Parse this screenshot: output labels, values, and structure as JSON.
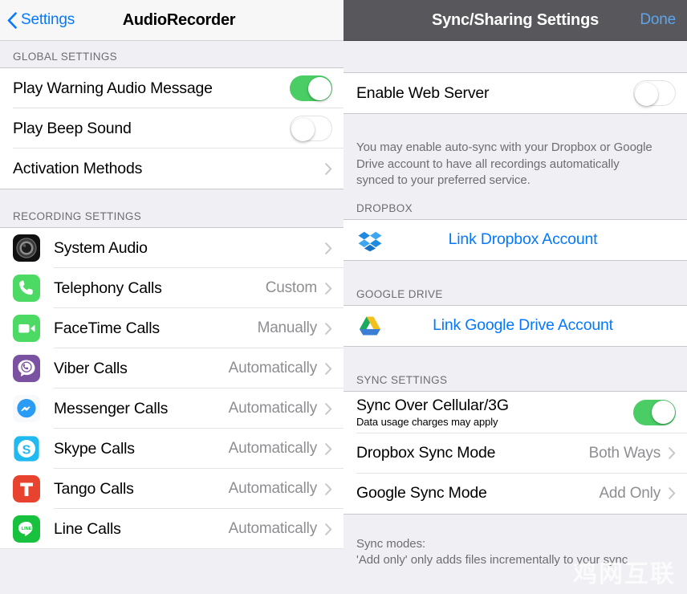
{
  "colors": {
    "accent_blue": "#0479ff",
    "done_blue": "#5ba5f0",
    "switch_on_green": "#4acd64",
    "navbar_dark": "#58585c",
    "navbar_light": "#f7f7f8",
    "group_bg": "#ffffff",
    "page_bg": "#efeff4",
    "separator": "#c8c7cc",
    "secondary_text": "#8e8e93",
    "section_header_text": "#6d6d72"
  },
  "left_panel": {
    "navbar": {
      "back_label": "Settings",
      "back_icon": "chevron-left-icon",
      "title": "AudioRecorder"
    },
    "sections": [
      {
        "header": "GLOBAL SETTINGS",
        "rows": [
          {
            "label": "Play Warning Audio Message",
            "control": "switch",
            "switch_state": "on"
          },
          {
            "label": "Play Beep Sound",
            "control": "switch",
            "switch_state": "off"
          },
          {
            "label": "Activation Methods",
            "control": "chevron",
            "detail": ""
          }
        ]
      },
      {
        "header": "RECORDING SETTINGS",
        "rows": [
          {
            "label": "System Audio",
            "icon": "system-audio-icon",
            "detail": "",
            "control": "chevron"
          },
          {
            "label": "Telephony Calls",
            "icon": "phone-icon",
            "detail": "Custom",
            "control": "chevron"
          },
          {
            "label": "FaceTime Calls",
            "icon": "facetime-icon",
            "detail": "Manually",
            "control": "chevron"
          },
          {
            "label": "Viber Calls",
            "icon": "viber-icon",
            "detail": "Automatically",
            "control": "chevron"
          },
          {
            "label": "Messenger Calls",
            "icon": "messenger-icon",
            "detail": "Automatically",
            "control": "chevron"
          },
          {
            "label": "Skype Calls",
            "icon": "skype-icon",
            "detail": "Automatically",
            "control": "chevron"
          },
          {
            "label": "Tango Calls",
            "icon": "tango-icon",
            "detail": "Automatically",
            "control": "chevron"
          },
          {
            "label": "Line Calls",
            "icon": "line-icon",
            "detail": "Automatically",
            "control": "chevron"
          }
        ]
      }
    ]
  },
  "right_panel": {
    "navbar": {
      "title": "Sync/Sharing Settings",
      "done_label": "Done"
    },
    "web_server_row": {
      "label": "Enable Web Server",
      "control": "switch",
      "switch_state": "off"
    },
    "intro_note": "You may enable auto-sync with your Dropbox or Google\nDrive account to have all recordings automatically\nsynced to your preferred service.",
    "dropbox_section": {
      "header": "DROPBOX",
      "link_label": "Link Dropbox Account",
      "icon": "dropbox-icon"
    },
    "google_drive_section": {
      "header": "GOOGLE DRIVE",
      "link_label": "Link Google Drive Account",
      "icon": "google-drive-icon"
    },
    "sync_settings_section": {
      "header": "SYNC SETTINGS",
      "rows": [
        {
          "label": "Sync Over Cellular/3G",
          "sublabel": "Data usage charges may apply",
          "control": "switch",
          "switch_state": "on"
        },
        {
          "label": "Dropbox Sync Mode",
          "detail": "Both Ways",
          "control": "chevron"
        },
        {
          "label": "Google Sync Mode",
          "detail": "Add Only",
          "control": "chevron"
        }
      ]
    },
    "footer_note_line1": "Sync modes:",
    "footer_note_line2": "     'Add only' only adds files incrementally to your sync"
  },
  "watermark": {
    "text": "鸡网互联"
  }
}
